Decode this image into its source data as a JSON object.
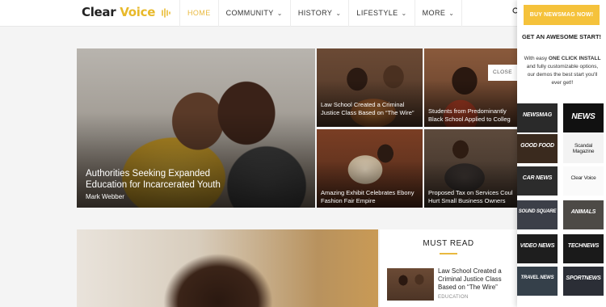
{
  "header": {
    "logo_part1": "Clear ",
    "logo_part2": "Voice",
    "nav": [
      {
        "label": "HOME",
        "active": true
      },
      {
        "label": "COMMUNITY",
        "dropdown": true
      },
      {
        "label": "HISTORY",
        "dropdown": true
      },
      {
        "label": "LIFESTYLE",
        "dropdown": true
      },
      {
        "label": "MORE",
        "dropdown": true
      }
    ]
  },
  "featured": {
    "main": {
      "title": "Authorities Seeking Expanded Education for Incarcerated Youth",
      "author": "Mark Webber"
    },
    "tiles": [
      {
        "title": "Law School Created a Criminal Justice Class Based on “The Wire”"
      },
      {
        "title": "Students from Predominantly Black School Applied to Colleg"
      },
      {
        "title": "Amazing Exhibit Celebrates Ebony Fashion Fair Empire"
      },
      {
        "title": "Proposed Tax on Services Coul Hurt Small Business Owners"
      }
    ]
  },
  "must_read": {
    "heading": "MUST READ",
    "item_title": "Law School Created a Criminal Justice Class Based on “The Wire”",
    "item_category": "EDUCATION"
  },
  "panel": {
    "buy_button": "BUY NEWSMAG NOW!",
    "heading": "GET AN AWESOME START!",
    "text_before": "With easy ",
    "text_bold": "ONE CLICK INSTALL",
    "text_after": " and fully customizable options, our demos the best start you'll ever get!!",
    "close_label": "CLOSE",
    "demos": [
      "NEWSMAG",
      "NEWS",
      "GOOD FOOD",
      "Scandal Magazine",
      "CAR NEWS",
      "Clear Voice",
      "SOUND SQUARE",
      "ANIMALS",
      "VIDEO NEWS",
      "TECHNEWS",
      "TRAVEL NEWS",
      "SPORTNEWS"
    ]
  },
  "colors": {
    "accent": "#e9b93f",
    "buy_button": "#f5c23b"
  }
}
